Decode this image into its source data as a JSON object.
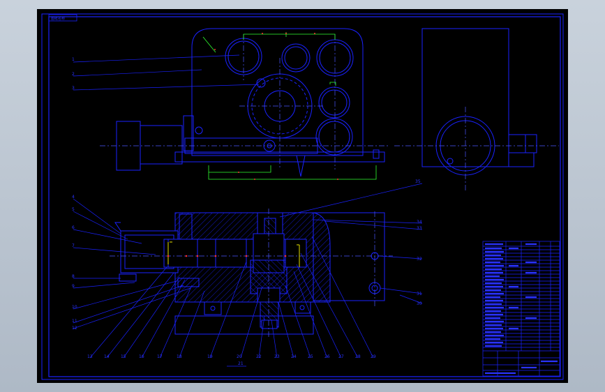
{
  "drawing": {
    "title_block_label": "图纸名称",
    "colors": {
      "background": "#000000",
      "line": "#1a22ff",
      "dimension": "#30ff30",
      "center": "#4a55ff",
      "note": "#ff3030",
      "mark": "#e6e000"
    },
    "part_labels_left_top": [
      "1",
      "2",
      "3"
    ],
    "part_labels_left_mid": [
      "4",
      "5",
      "6",
      "7",
      "8",
      "9",
      "10",
      "11",
      "12"
    ],
    "part_labels_bottom": [
      "13",
      "14",
      "15",
      "16",
      "17",
      "18",
      "19",
      "20",
      "21",
      "22",
      "23",
      "24",
      "25",
      "26",
      "27",
      "28",
      "29"
    ],
    "part_labels_right": [
      "35",
      "34",
      "33",
      "32",
      "31",
      "30"
    ]
  }
}
